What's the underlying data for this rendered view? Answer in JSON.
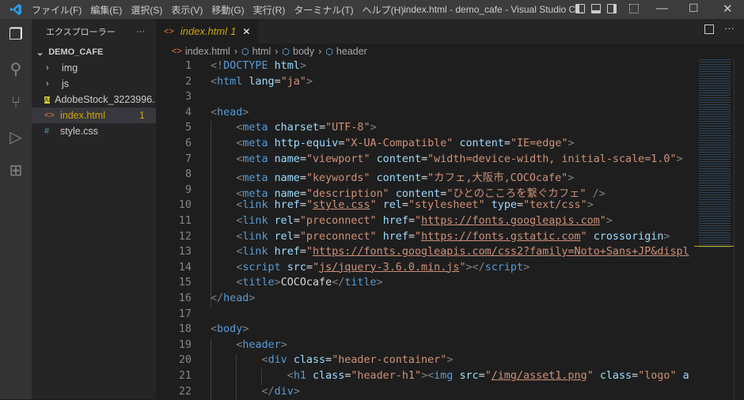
{
  "menu": [
    "ファイル(F)",
    "編集(E)",
    "選択(S)",
    "表示(V)",
    "移動(G)",
    "実行(R)",
    "ターミナル(T)",
    "ヘルプ(H)"
  ],
  "window_title": "index.html - demo_cafe - Visual Studio C...",
  "explorer": {
    "title": "エクスプローラー",
    "more": "···",
    "folder": "DEMO_CAFE",
    "items": [
      {
        "label": "img",
        "type": "folder"
      },
      {
        "label": "js",
        "type": "folder"
      },
      {
        "label": "AdobeStock_3223996...",
        "type": "ai"
      },
      {
        "label": "index.html",
        "type": "html",
        "badge": "1"
      },
      {
        "label": "style.css",
        "type": "css"
      }
    ]
  },
  "tab": {
    "label": "index.html",
    "badge": "1",
    "close": "✕"
  },
  "breadcrumb": [
    "index.html",
    "html",
    "body",
    "header"
  ],
  "code": [
    [
      [
        "p",
        "<!"
      ],
      [
        "t",
        "DOCTYPE"
      ],
      [
        "x",
        " "
      ],
      [
        "a",
        "html"
      ],
      [
        "p",
        ">"
      ]
    ],
    [
      [
        "p",
        "<"
      ],
      [
        "t",
        "html"
      ],
      [
        "x",
        " "
      ],
      [
        "a",
        "lang"
      ],
      [
        "x",
        "="
      ],
      [
        "s",
        "\"ja\""
      ],
      [
        "p",
        ">"
      ]
    ],
    [],
    [
      [
        "p",
        "<"
      ],
      [
        "t",
        "head"
      ],
      [
        "p",
        ">"
      ]
    ],
    [
      [
        "x",
        "    "
      ],
      [
        "p",
        "<"
      ],
      [
        "t",
        "meta"
      ],
      [
        "x",
        " "
      ],
      [
        "a",
        "charset"
      ],
      [
        "x",
        "="
      ],
      [
        "s",
        "\"UTF-8\""
      ],
      [
        "p",
        ">"
      ]
    ],
    [
      [
        "x",
        "    "
      ],
      [
        "p",
        "<"
      ],
      [
        "t",
        "meta"
      ],
      [
        "x",
        " "
      ],
      [
        "a",
        "http-equiv"
      ],
      [
        "x",
        "="
      ],
      [
        "s",
        "\"X-UA-Compatible\""
      ],
      [
        "x",
        " "
      ],
      [
        "a",
        "content"
      ],
      [
        "x",
        "="
      ],
      [
        "s",
        "\"IE=edge\""
      ],
      [
        "p",
        ">"
      ]
    ],
    [
      [
        "x",
        "    "
      ],
      [
        "p",
        "<"
      ],
      [
        "t",
        "meta"
      ],
      [
        "x",
        " "
      ],
      [
        "a",
        "name"
      ],
      [
        "x",
        "="
      ],
      [
        "s",
        "\"viewport\""
      ],
      [
        "x",
        " "
      ],
      [
        "a",
        "content"
      ],
      [
        "x",
        "="
      ],
      [
        "s",
        "\"width=device-width, initial-scale=1.0\""
      ],
      [
        "p",
        ">"
      ]
    ],
    [
      [
        "x",
        "    "
      ],
      [
        "p",
        "<"
      ],
      [
        "t",
        "meta"
      ],
      [
        "x",
        " "
      ],
      [
        "a",
        "name"
      ],
      [
        "x",
        "="
      ],
      [
        "s",
        "\"keywords\""
      ],
      [
        "x",
        " "
      ],
      [
        "a",
        "content"
      ],
      [
        "x",
        "="
      ],
      [
        "s",
        "\"カフェ,大阪市,COCOcafe\""
      ],
      [
        "p",
        ">"
      ]
    ],
    [
      [
        "x",
        "    "
      ],
      [
        "p",
        "<"
      ],
      [
        "t",
        "meta"
      ],
      [
        "x",
        " "
      ],
      [
        "a",
        "name"
      ],
      [
        "x",
        "="
      ],
      [
        "s",
        "\"description\""
      ],
      [
        "x",
        " "
      ],
      [
        "a",
        "content"
      ],
      [
        "x",
        "="
      ],
      [
        "s",
        "\"ひとのこころを繋ぐカフェ\""
      ],
      [
        "x",
        " "
      ],
      [
        "p",
        "/>"
      ]
    ],
    [
      [
        "x",
        "    "
      ],
      [
        "p",
        "<"
      ],
      [
        "t",
        "link"
      ],
      [
        "x",
        " "
      ],
      [
        "a",
        "href"
      ],
      [
        "x",
        "="
      ],
      [
        "s",
        "\""
      ],
      [
        "u",
        "style.css"
      ],
      [
        "s",
        "\""
      ],
      [
        "x",
        " "
      ],
      [
        "a",
        "rel"
      ],
      [
        "x",
        "="
      ],
      [
        "s",
        "\"stylesheet\""
      ],
      [
        "x",
        " "
      ],
      [
        "a",
        "type"
      ],
      [
        "x",
        "="
      ],
      [
        "s",
        "\"text/css\""
      ],
      [
        "p",
        ">"
      ]
    ],
    [
      [
        "x",
        "    "
      ],
      [
        "p",
        "<"
      ],
      [
        "t",
        "link"
      ],
      [
        "x",
        " "
      ],
      [
        "a",
        "rel"
      ],
      [
        "x",
        "="
      ],
      [
        "s",
        "\"preconnect\""
      ],
      [
        "x",
        " "
      ],
      [
        "a",
        "href"
      ],
      [
        "x",
        "="
      ],
      [
        "s",
        "\""
      ],
      [
        "u",
        "https://fonts.googleapis.com"
      ],
      [
        "s",
        "\""
      ],
      [
        "p",
        ">"
      ]
    ],
    [
      [
        "x",
        "    "
      ],
      [
        "p",
        "<"
      ],
      [
        "t",
        "link"
      ],
      [
        "x",
        " "
      ],
      [
        "a",
        "rel"
      ],
      [
        "x",
        "="
      ],
      [
        "s",
        "\"preconnect\""
      ],
      [
        "x",
        " "
      ],
      [
        "a",
        "href"
      ],
      [
        "x",
        "="
      ],
      [
        "s",
        "\""
      ],
      [
        "u",
        "https://fonts.gstatic.com"
      ],
      [
        "s",
        "\""
      ],
      [
        "x",
        " "
      ],
      [
        "a",
        "crossorigin"
      ],
      [
        "p",
        ">"
      ]
    ],
    [
      [
        "x",
        "    "
      ],
      [
        "p",
        "<"
      ],
      [
        "t",
        "link"
      ],
      [
        "x",
        " "
      ],
      [
        "a",
        "href"
      ],
      [
        "x",
        "="
      ],
      [
        "s",
        "\""
      ],
      [
        "u",
        "https://fonts.googleapis.com/css2?family=Noto+Sans+JP&displ"
      ]
    ],
    [
      [
        "x",
        "    "
      ],
      [
        "p",
        "<"
      ],
      [
        "t",
        "script"
      ],
      [
        "x",
        " "
      ],
      [
        "a",
        "src"
      ],
      [
        "x",
        "="
      ],
      [
        "s",
        "\""
      ],
      [
        "u",
        "js/jquery-3.6.0.min.js"
      ],
      [
        "s",
        "\""
      ],
      [
        "p",
        "></"
      ],
      [
        "t",
        "script"
      ],
      [
        "p",
        ">"
      ]
    ],
    [
      [
        "x",
        "    "
      ],
      [
        "p",
        "<"
      ],
      [
        "t",
        "title"
      ],
      [
        "p",
        ">"
      ],
      [
        "x",
        "COCOcafe"
      ],
      [
        "p",
        "</"
      ],
      [
        "t",
        "title"
      ],
      [
        "p",
        ">"
      ]
    ],
    [
      [
        "p",
        "</"
      ],
      [
        "t",
        "head"
      ],
      [
        "p",
        ">"
      ]
    ],
    [],
    [
      [
        "p",
        "<"
      ],
      [
        "t",
        "body"
      ],
      [
        "p",
        ">"
      ]
    ],
    [
      [
        "x",
        "    "
      ],
      [
        "p",
        "<"
      ],
      [
        "t",
        "header"
      ],
      [
        "p",
        ">"
      ]
    ],
    [
      [
        "x",
        "        "
      ],
      [
        "p",
        "<"
      ],
      [
        "t",
        "div"
      ],
      [
        "x",
        " "
      ],
      [
        "a",
        "class"
      ],
      [
        "x",
        "="
      ],
      [
        "s",
        "\"header-container\""
      ],
      [
        "p",
        ">"
      ]
    ],
    [
      [
        "x",
        "            "
      ],
      [
        "p",
        "<"
      ],
      [
        "t",
        "h1"
      ],
      [
        "x",
        " "
      ],
      [
        "a",
        "class"
      ],
      [
        "x",
        "="
      ],
      [
        "s",
        "\"header-h1\""
      ],
      [
        "p",
        "><"
      ],
      [
        "t",
        "img"
      ],
      [
        "x",
        " "
      ],
      [
        "a",
        "src"
      ],
      [
        "x",
        "="
      ],
      [
        "s",
        "\""
      ],
      [
        "u",
        "/img/asset1.png"
      ],
      [
        "s",
        "\""
      ],
      [
        "x",
        " "
      ],
      [
        "a",
        "class"
      ],
      [
        "x",
        "="
      ],
      [
        "s",
        "\"logo\""
      ],
      [
        "x",
        " "
      ],
      [
        "a",
        "a"
      ]
    ],
    [
      [
        "x",
        "        "
      ],
      [
        "p",
        "</"
      ],
      [
        "t",
        "div"
      ],
      [
        "p",
        ">"
      ]
    ]
  ]
}
